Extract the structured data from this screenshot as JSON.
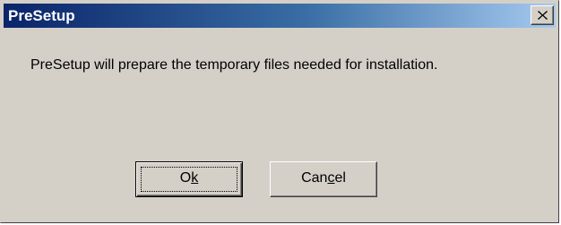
{
  "window": {
    "title": "PreSetup",
    "close_glyph": "×"
  },
  "message": "PreSetup will prepare the temporary files needed for installation.",
  "buttons": {
    "ok": {
      "pre": "O",
      "mnemonic": "k",
      "post": ""
    },
    "cancel": {
      "pre": "Can",
      "mnemonic": "c",
      "post": "el"
    }
  },
  "colors": {
    "titlebar_start": "#0a246a",
    "titlebar_end": "#a6caf0",
    "face": "#d4d0c8"
  },
  "icons": {
    "close": "close-icon"
  }
}
